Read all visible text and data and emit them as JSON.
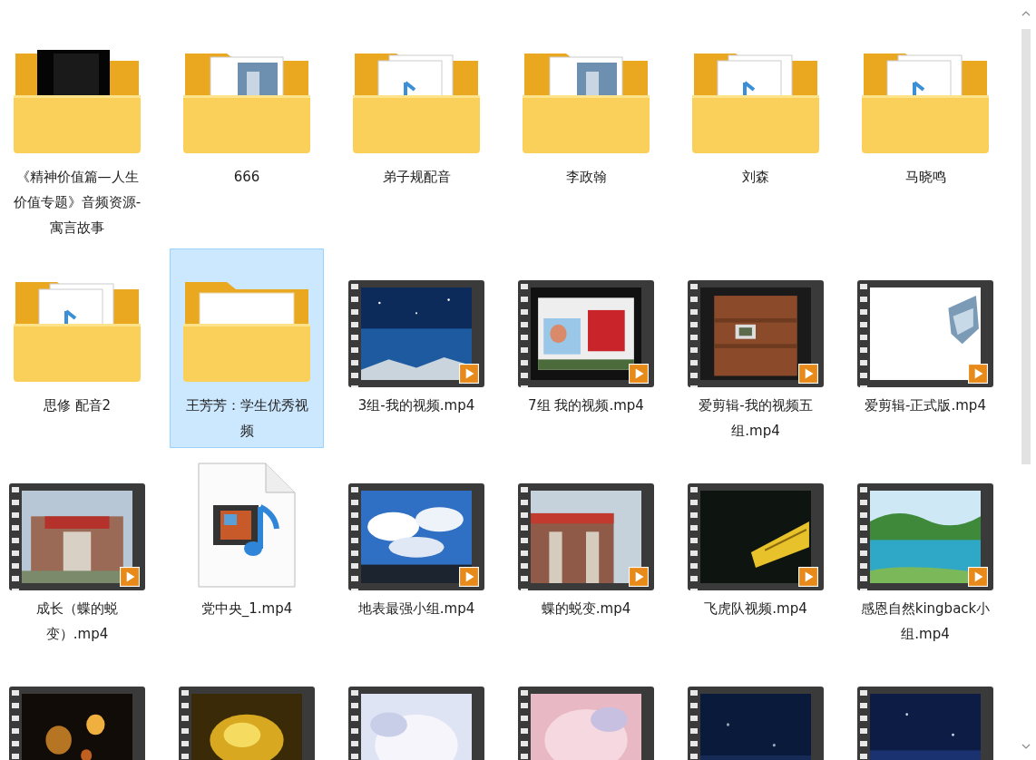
{
  "items": [
    {
      "kind": "folder",
      "label": "《精神价值篇—人生价值专题》音频资源-寓言故事",
      "selected": false
    },
    {
      "kind": "folder",
      "label": "666",
      "selected": false
    },
    {
      "kind": "folder",
      "label": "弟子规配音",
      "selected": false
    },
    {
      "kind": "folder",
      "label": "李政翰",
      "selected": false
    },
    {
      "kind": "folder",
      "label": "刘森",
      "selected": false
    },
    {
      "kind": "folder",
      "label": "马晓鸣",
      "selected": false
    },
    {
      "kind": "folder",
      "label": "思修 配音2",
      "selected": false
    },
    {
      "kind": "folder",
      "label": "王芳芳：学生优秀视频",
      "selected": true
    },
    {
      "kind": "video",
      "label": "3组-我的视频.mp4",
      "selected": false
    },
    {
      "kind": "video",
      "label": "7组 我的视频.mp4",
      "selected": false
    },
    {
      "kind": "video",
      "label": "爱剪辑-我的视频五组.mp4",
      "selected": false
    },
    {
      "kind": "video",
      "label": "爱剪辑-正式版.mp4",
      "selected": false
    },
    {
      "kind": "video",
      "label": "成长（蝶的蜕变）.mp4",
      "selected": false
    },
    {
      "kind": "file",
      "label": "党中央_1.mp4",
      "selected": false
    },
    {
      "kind": "video",
      "label": "地表最强小组.mp4",
      "selected": false
    },
    {
      "kind": "video",
      "label": "蝶的蜕变.mp4",
      "selected": false
    },
    {
      "kind": "video",
      "label": "飞虎队视频.mp4",
      "selected": false
    },
    {
      "kind": "video",
      "label": "感恩自然kingback小组.mp4",
      "selected": false
    },
    {
      "kind": "video",
      "selected": false
    },
    {
      "kind": "video",
      "selected": false
    },
    {
      "kind": "video",
      "selected": false
    },
    {
      "kind": "video",
      "selected": false
    },
    {
      "kind": "video",
      "selected": false
    },
    {
      "kind": "video",
      "selected": false
    }
  ]
}
